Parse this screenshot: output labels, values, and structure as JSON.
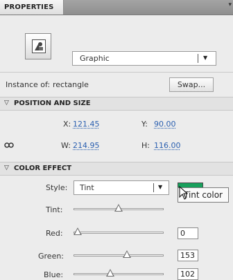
{
  "tab": {
    "label": "PROPERTIES"
  },
  "symbol": {
    "type_label": "Graphic"
  },
  "instance": {
    "label": "Instance of:",
    "name": "rectangle",
    "swap_label": "Swap..."
  },
  "position_size": {
    "title": "POSITION AND SIZE",
    "x_label": "X:",
    "x_value": "121.45",
    "y_label": "Y:",
    "y_value": "90.00",
    "w_label": "W:",
    "w_value": "214.95",
    "h_label": "H:",
    "h_value": "116.00"
  },
  "color_effect": {
    "title": "COLOR EFFECT",
    "style_label": "Style:",
    "style_value": "Tint",
    "tint_color": "#18a05c",
    "tooltip": "Tint color",
    "tint_label": "Tint:",
    "tint_level": 0.5,
    "red_label": "Red:",
    "red_value": "0",
    "red_level": 0,
    "green_label": "Green:",
    "green_value": "153",
    "green_level": 0.6,
    "blue_label": "Blue:",
    "blue_value": "102",
    "blue_level": 0.4
  },
  "icons": {
    "panel_menu": "panel-menu-icon",
    "symbol": "graphic-symbol-icon",
    "link": "chain-link-icon",
    "collapse": "collapse-triangle-icon",
    "cursor": "mouse-pointer-icon"
  }
}
